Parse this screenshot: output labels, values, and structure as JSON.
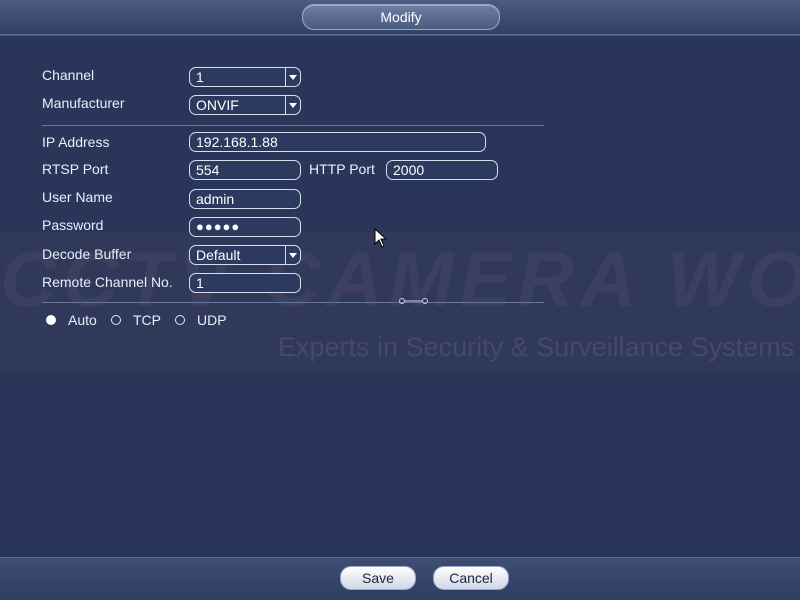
{
  "dialog": {
    "title": "Modify"
  },
  "form": {
    "channel": {
      "label": "Channel",
      "value": "1"
    },
    "manufacturer": {
      "label": "Manufacturer",
      "value": "ONVIF"
    },
    "ip_address": {
      "label": "IP Address",
      "value": "192.168.1.88"
    },
    "rtsp_port": {
      "label": "RTSP Port",
      "value": "554"
    },
    "http_port": {
      "label": "HTTP Port",
      "value": "2000"
    },
    "user_name": {
      "label": "User Name",
      "value": "admin"
    },
    "password": {
      "label": "Password",
      "value": "●●●●●"
    },
    "decode_buffer": {
      "label": "Decode Buffer",
      "value": "Default"
    },
    "remote_channel": {
      "label": "Remote Channel No.",
      "value": "1"
    },
    "protocol": {
      "options": [
        "Auto",
        "TCP",
        "UDP"
      ],
      "selected": "Auto"
    }
  },
  "watermark": {
    "main": "CCTV CAMERA WORLD",
    "sub": "Experts in Security & Surveillance Systems"
  },
  "buttons": {
    "save": "Save",
    "cancel": "Cancel"
  },
  "colors": {
    "background": "#293659",
    "field_border": "#d7deee",
    "accent": "#ffffff"
  }
}
